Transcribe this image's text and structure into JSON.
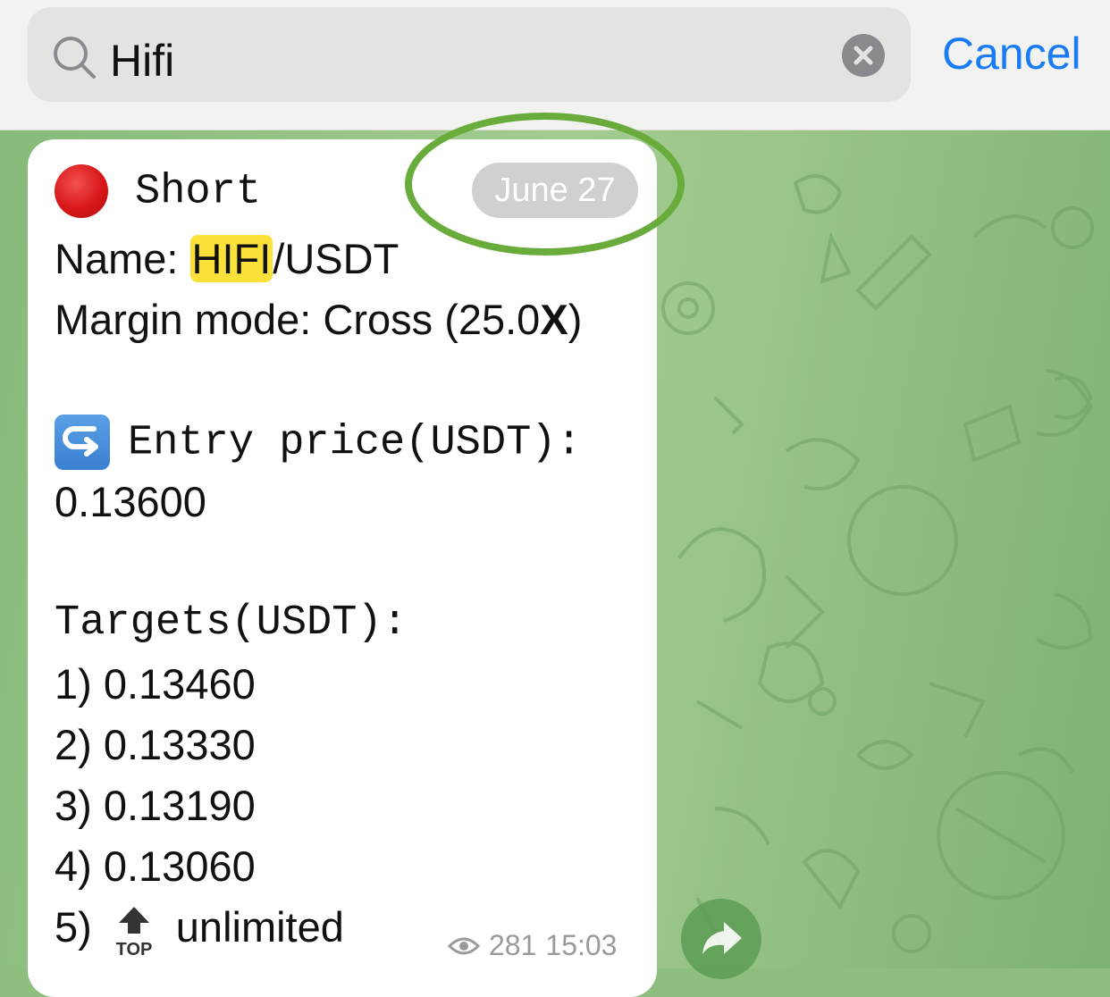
{
  "search": {
    "query": "Hifi",
    "cancel_label": "Cancel"
  },
  "message": {
    "title": "Short",
    "date": "June 27",
    "name_label": "Name: ",
    "name_highlight": "HIFI",
    "name_rest": "/USDT",
    "margin_text": "Margin mode: Cross (25.0",
    "margin_x": "X",
    "margin_close": ")",
    "entry_label": "Entry price(USDT):",
    "entry_value": "0.13600",
    "targets_label": "Targets(USDT):",
    "targets": [
      "1) 0.13460",
      "2) 0.13330",
      "3) 0.13190",
      "4) 0.13060"
    ],
    "target5_prefix": "5)",
    "target5_value": "unlimited",
    "views": "281",
    "time": "15:03"
  },
  "icons": {
    "search": "search-icon",
    "clear": "clear-icon",
    "entry": "entry-arrow-icon",
    "top": "top-arrow-icon",
    "eye": "eye-icon",
    "forward": "forward-icon"
  },
  "colors": {
    "accent": "#1a7cf5",
    "highlight": "#fbe13a",
    "annotation": "#6aac3c",
    "wallpaper": "#9cc78a"
  }
}
